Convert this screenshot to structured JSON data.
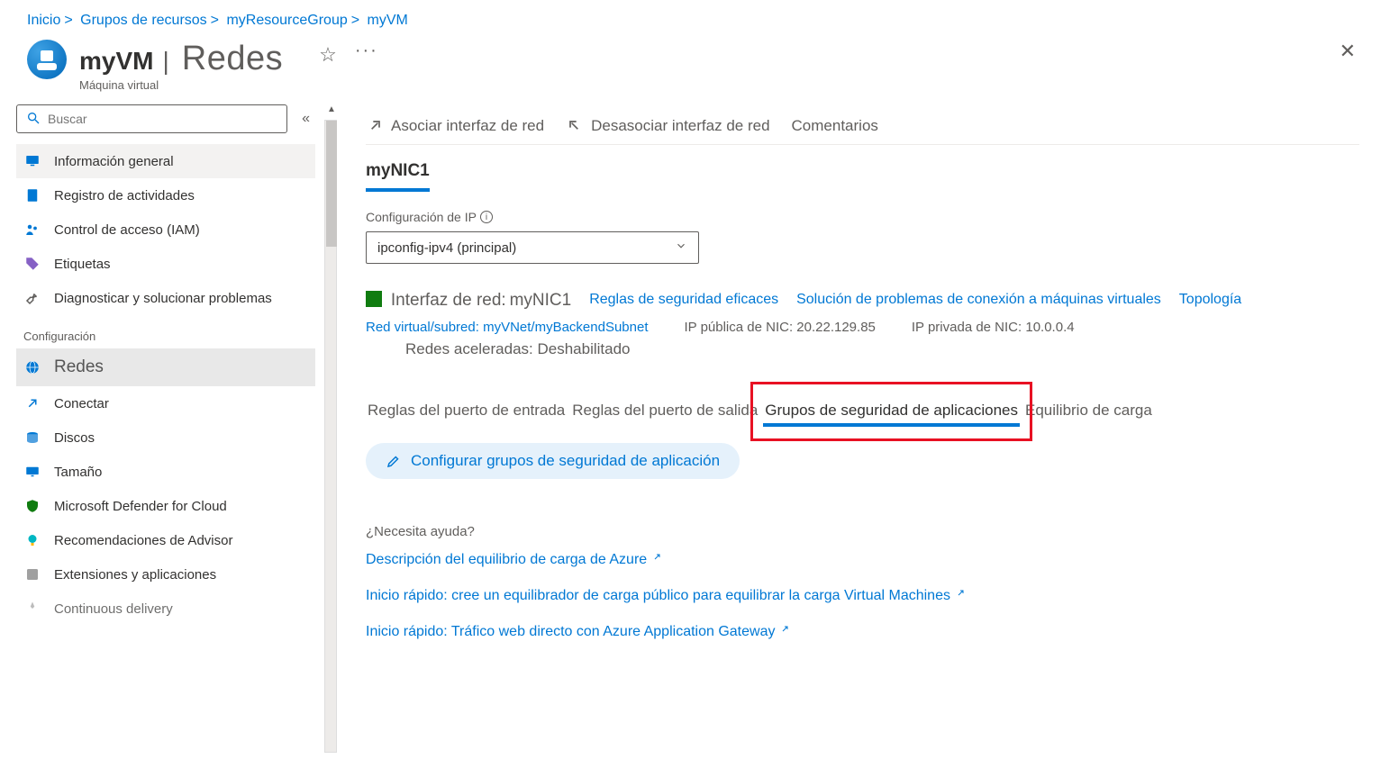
{
  "breadcrumbs": {
    "home": "Inicio",
    "groups": "Grupos de recursos",
    "rg": "myResourceGroup",
    "vm": "myVM"
  },
  "header": {
    "vm_name": "myVM",
    "section": "Redes",
    "subtitle": "Máquina virtual"
  },
  "search": {
    "placeholder": "Buscar"
  },
  "sidebar": {
    "items": [
      {
        "label": "Información general"
      },
      {
        "label": "Registro de actividades"
      },
      {
        "label": "Control de acceso (IAM)"
      },
      {
        "label": "Etiquetas"
      },
      {
        "label": "Diagnosticar y solucionar problemas"
      }
    ],
    "section_label": "Configuración",
    "config_items": [
      {
        "label": "Redes"
      },
      {
        "label": "Conectar"
      },
      {
        "label": "Discos"
      },
      {
        "label": "Tamaño"
      },
      {
        "label": "Microsoft Defender for Cloud"
      },
      {
        "label": "Recomendaciones de Advisor"
      },
      {
        "label": "Extensiones y aplicaciones"
      },
      {
        "label": "Continuous delivery"
      }
    ]
  },
  "toolbar": {
    "assoc": "Asociar interfaz de red",
    "disassoc": "Desasociar interfaz de red",
    "feedback": "Comentarios"
  },
  "nic": {
    "tab": "myNIC1",
    "ip_config_label": "Configuración de IP",
    "ip_config_value": "ipconfig-ipv4 (principal)",
    "interface_label": "Interfaz de red:",
    "interface_name": "myNIC1",
    "rules_link": "Reglas de seguridad eficaces",
    "troubleshoot_link": "Solución de problemas de conexión a máquinas virtuales",
    "topology_link": "Topología",
    "vnet_label": "Red virtual/subred:",
    "vnet_value": "myVNet/myBackendSubnet",
    "public_ip_label": "IP pública de NIC:",
    "public_ip_value": "20.22.129.85",
    "private_ip_label": "IP privada de NIC:",
    "private_ip_value": "10.0.0.4",
    "accel_label": "Redes aceleradas:",
    "accel_value": "Deshabilitado"
  },
  "rule_tabs": {
    "inbound": "Reglas del puerto de entrada",
    "outbound": "Reglas del puerto de salida",
    "asg": "Grupos de seguridad de aplicaciones",
    "lb": "Equilibrio de carga"
  },
  "config_asg_button": "Configurar grupos de seguridad de aplicación",
  "help": {
    "heading": "¿Necesita ayuda?",
    "link1": "Descripción del equilibrio de carga de Azure",
    "link2": "Inicio rápido: cree un equilibrador de carga público para equilibrar la carga Virtual Machines",
    "link3": "Inicio rápido: Tráfico web directo con Azure Application Gateway"
  }
}
